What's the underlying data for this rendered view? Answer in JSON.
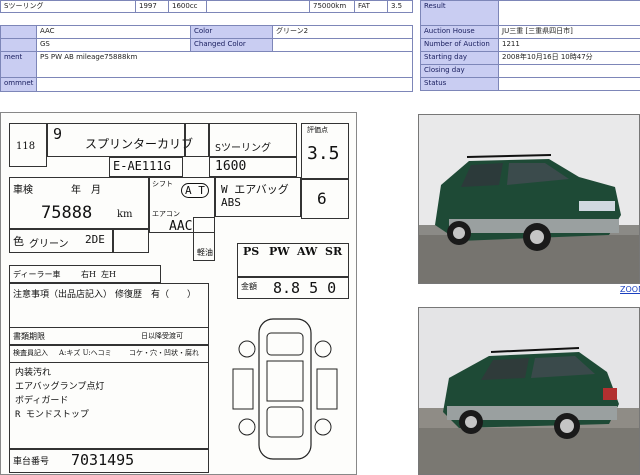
{
  "top_row": {
    "grade": "Sツーリング",
    "year": "1997",
    "cc": "1600cc",
    "blank": "",
    "mileage": "75000km",
    "transmission": "FAT",
    "score": "3.5"
  },
  "details": {
    "aac_label": "",
    "aac_value": "AAC",
    "color_label": "Color",
    "color_value": "グリーン2",
    "gs_label": "",
    "gs_value": "GS",
    "changed_color_label": "Changed Color",
    "changed_color_value": "",
    "equipment_label": "ment",
    "equipment_value": "PS PW AB mileage75888km",
    "comment_label": "ommnet",
    "comment_value": ""
  },
  "auction": {
    "result_label": "Result",
    "result_value": "",
    "house_label": "Auction House",
    "house_value": "JU三重 [三重県四日市]",
    "number_label": "Number of Auction",
    "number_value": "1211",
    "start_label": "Starting day",
    "start_value": "2008年10月16日 10時47分",
    "closing_label": "Closing day",
    "closing_value": "",
    "status_label": "Status",
    "status_value": ""
  },
  "sheet": {
    "lot": "118",
    "nine": "9",
    "name_hand": "スプリンターカリブ",
    "grade_hand": "Sツーリング",
    "model_code": "E-AE111G",
    "cc_hand": "1600",
    "score_header": "評価点",
    "score_hand": "3.5",
    "shaken": "車検",
    "year_month": "年　月",
    "mileage_hand": "75888",
    "km": "km",
    "shift": "シフト",
    "at": "A T",
    "aircon": "エアコン",
    "aac": "AAC",
    "wheels": "W エアバッグ ABS",
    "seats_hand": "6",
    "color_label": "色",
    "color_hand": "グリーン",
    "color_code": "2DE",
    "fuel": "軽油",
    "ps": "PS",
    "pw": "PW",
    "aw": "AW",
    "sr": "SR",
    "dealer": "ディーラー車",
    "lhd": "右H",
    "rhd": "左H",
    "kin": "金額",
    "price_hand": "8.8 5 0",
    "notes_title": "注意事項（出品店記入）",
    "repair": "修復歴",
    "repair_has": "有（　　）",
    "docs": "書類期限",
    "docs_date": "日以降受渡可",
    "inspector": "検査員記入",
    "inspector_legend": "A:キズ U:ヘコミ",
    "comments": "コケ・穴・凹状・腐れ",
    "note1": "内装汚れ",
    "note2": "エアバッグランプ点灯",
    "note3": "ボディガード",
    "note4": "R モンドストップ",
    "chassis_label": "車台番号",
    "chassis_hand": "7031495"
  },
  "zoom_label": "ZOOM",
  "colors": {
    "label_bg": "#c9cdf2",
    "border": "#7d86b8",
    "car_body": "#1e4a36",
    "car_trim": "#9aa0a0"
  }
}
